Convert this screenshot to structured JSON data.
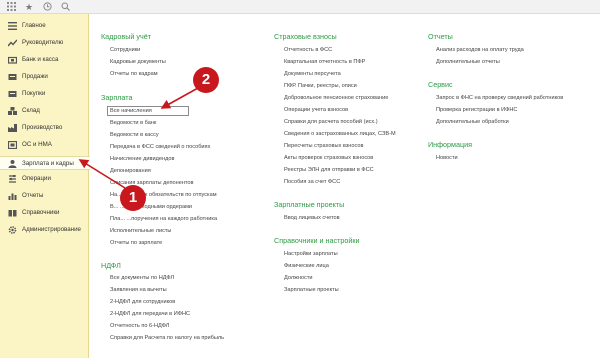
{
  "toolbar": {
    "icons": [
      "grid-icon",
      "star-icon",
      "history-icon",
      "search-icon"
    ]
  },
  "sidebar": {
    "items": [
      {
        "label": "Главное",
        "icon": "list-icon"
      },
      {
        "label": "Руководителю",
        "icon": "chart-icon"
      },
      {
        "label": "Банк и касса",
        "icon": "bank-icon"
      },
      {
        "label": "Продажи",
        "icon": "sales-icon"
      },
      {
        "label": "Покупки",
        "icon": "cart-icon"
      },
      {
        "label": "Склад",
        "icon": "warehouse-icon"
      },
      {
        "label": "Производство",
        "icon": "factory-icon"
      },
      {
        "label": "ОС и НМА",
        "icon": "assets-icon"
      },
      {
        "label": "Зарплата и кадры",
        "icon": "person-icon"
      },
      {
        "label": "Операции",
        "icon": "operations-icon"
      },
      {
        "label": "Отчеты",
        "icon": "reports-icon"
      },
      {
        "label": "Справочники",
        "icon": "book-icon"
      },
      {
        "label": "Администрирование",
        "icon": "gear-icon"
      }
    ],
    "active_index": 8
  },
  "col1": {
    "hr_title": "Кадровый учёт",
    "hr_links": [
      "Сотрудники",
      "Кадровые документы",
      "Отчеты по кадрам"
    ],
    "salary_title": "Зарплата",
    "salary_links": [
      "Все начисления",
      "Ведомости в банк",
      "Ведомости в кассу",
      "Передача в ФСС сведений о пособиях",
      "Начисление дивидендов",
      "Депонирования",
      "Списания зарплаты депонентов",
      "На... ...денных обязательств по отпускам",
      "В... ...ты расходными ордерами",
      "Пла... ...поручения на каждого работника",
      "Исполнительные листы",
      "Отчеты по зарплате"
    ],
    "ndfl_title": "НДФЛ",
    "ndfl_links": [
      "Все документы по НДФЛ",
      "Заявления на вычеты",
      "2-НДФЛ для сотрудников",
      "2-НДФЛ для передачи в ИФНС",
      "Отчетность по 6-НДФЛ",
      "Справки для Расчета по налогу на прибыль"
    ]
  },
  "col2": {
    "ins_title": "Страховые взносы",
    "ins_links": [
      "Отчетность в ФСС",
      "Квартальная отчетность в ПФР",
      "Документы персучета",
      "ПФР. Пачки, реестры, описи",
      "Добровольное пенсионное страхование",
      "Операции учета взносов",
      "Справки для расчета пособий (исх.)",
      "Сведения о застрахованных лицах, СЗВ-М",
      "Пересчеты страховых взносов",
      "Акты проверок страховых взносов",
      "Реестры ЭЛН для отправки в ФСС",
      "Пособия за счет ФСС"
    ],
    "projects_title": "Зарплатные проекты",
    "projects_links": [
      "Ввод лицевых счетов"
    ],
    "settings_title": "Справочники и настройки",
    "settings_links": [
      "Настройки зарплаты",
      "Физические лица",
      "Должности",
      "Зарплатные проекты"
    ]
  },
  "col3": {
    "reports_title": "Отчеты",
    "reports_links": [
      "Анализ расходов на оплату труда",
      "Дополнительные отчеты"
    ],
    "service_title": "Сервис",
    "service_links": [
      "Запрос в ФНС на проверку сведений работников",
      "Проверка регистрации в ИФНС",
      "Дополнительные обработки"
    ],
    "info_title": "Информация",
    "info_links": [
      "Новости"
    ]
  },
  "annotations": {
    "badge1": "1",
    "badge2": "2",
    "color": "#c8181e"
  }
}
